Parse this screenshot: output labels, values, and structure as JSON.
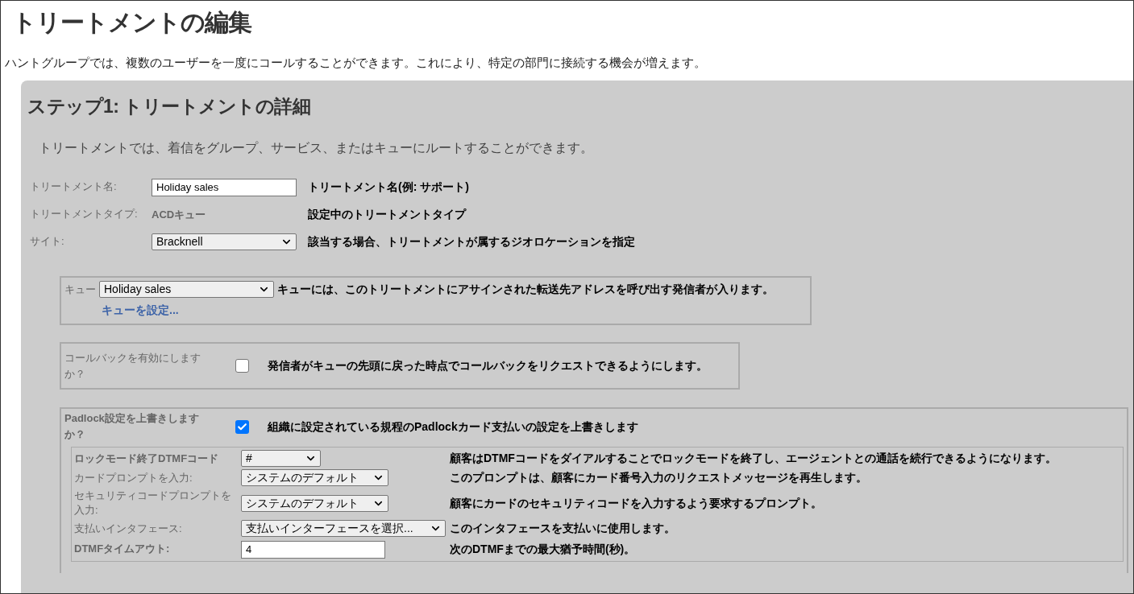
{
  "title": "トリートメントの編集",
  "intro": "ハントグループでは、複数のユーザーを一度にコールすることができます。これにより、特定の部門に接続する機会が増えます。",
  "step": {
    "heading": "ステップ1: トリートメントの詳細",
    "description": "トリートメントでは、着信をグループ、サービス、またはキューにルートすることができます。",
    "fields": [
      {
        "label": "トリートメント名:",
        "kind": "text",
        "value": "Holiday sales",
        "help": "トリートメント名(例: サポート)"
      },
      {
        "label": "トリートメントタイプ:",
        "kind": "static",
        "value": "ACDキュー",
        "help": "設定中のトリートメントタイプ"
      },
      {
        "label": "サイト:",
        "kind": "select",
        "value": "Bracknell",
        "help": "該当する場合、トリートメントが属するジオロケーションを指定"
      }
    ],
    "queue": {
      "label": "キュー",
      "value": "Holiday sales",
      "help": "キューには、このトリートメントにアサインされた転送先アドレスを呼び出す発信者が入ります。",
      "link": "キューを設定..."
    },
    "callback": {
      "label": "コールバックを有効にしますか？",
      "checked": false,
      "help": "発信者がキューの先頭に戻った時点でコールバックをリクエストできるようにします。"
    },
    "padlock": {
      "label": "Padlock設定を上書きしますか？",
      "checked": true,
      "help": "組織に設定されている規程のPadlockカード支払いの設定を上書きします",
      "fields": [
        {
          "label": "ロックモード終了DTMFコード",
          "kind": "select",
          "value": "#",
          "help": "顧客はDTMFコードをダイアルすることでロックモードを終了し、エージェントとの通話を続行できるようになります。"
        },
        {
          "label": "カードプロンプトを入力:",
          "kind": "select",
          "value": "システムのデフォルト",
          "help": "このプロンプトは、顧客にカード番号入力のリクエストメッセージを再生します。"
        },
        {
          "label": "セキュリティコードプロンプトを入力:",
          "kind": "select",
          "value": "システムのデフォルト",
          "help": "顧客にカードのセキュリティコードを入力するよう要求するプロンプト。"
        },
        {
          "label": "支払いインタフェース:",
          "kind": "select",
          "value": "支払いインターフェースを選択...",
          "help": "このインタフェースを支払いに使用します。"
        },
        {
          "label": "DTMFタイムアウト:",
          "kind": "text",
          "value": "4",
          "help": "次のDTMFまでの最大猶予時間(秒)。"
        }
      ]
    }
  }
}
